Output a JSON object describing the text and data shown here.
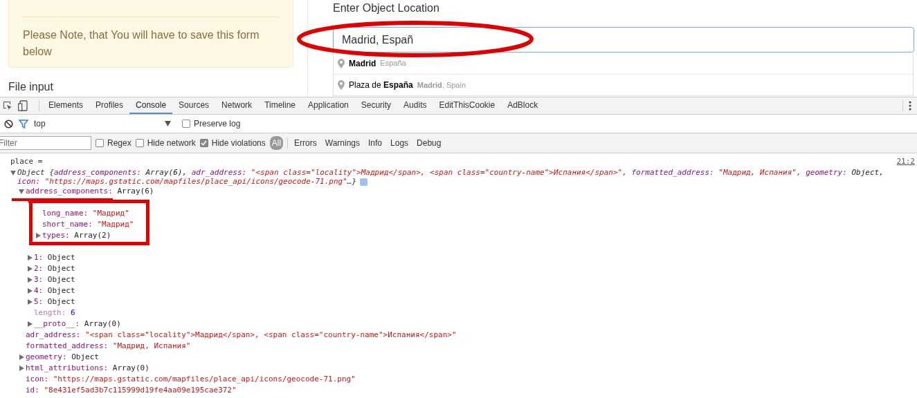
{
  "page": {
    "alert": {
      "text": "Please Note, that You will have to save this form below"
    },
    "file_label": "File input",
    "location": {
      "label": "Enter Object Location",
      "value": "Madrid, Españ",
      "suggestions": [
        {
          "main": "**Madrid**",
          "secondary": "España"
        },
        {
          "main": "Plaza de **España**",
          "secondary": "**Madrid**, Spain"
        }
      ]
    }
  },
  "devtools": {
    "tabs": [
      {
        "label": "Elements",
        "selected": false
      },
      {
        "label": "Profiles",
        "selected": false
      },
      {
        "label": "Console",
        "selected": true
      },
      {
        "label": "Sources",
        "selected": false
      },
      {
        "label": "Network",
        "selected": false
      },
      {
        "label": "Timeline",
        "selected": false
      },
      {
        "label": "Application",
        "selected": false
      },
      {
        "label": "Security",
        "selected": false
      },
      {
        "label": "Audits",
        "selected": false
      },
      {
        "label": "EditThisCookie",
        "selected": false
      },
      {
        "label": "AdBlock",
        "selected": false
      }
    ],
    "context": "top",
    "preserve_log": {
      "label": "Preserve log",
      "checked": false
    },
    "filter": {
      "placeholder": "Filter"
    },
    "options": [
      {
        "label": "Regex",
        "checked": false
      },
      {
        "label": "Hide network",
        "checked": false
      },
      {
        "label": "Hide violations",
        "checked": true
      }
    ],
    "levels": [
      {
        "label": "All",
        "selected": true
      },
      {
        "label": "Errors",
        "selected": false
      },
      {
        "label": "Warnings",
        "selected": false
      },
      {
        "label": "Info",
        "selected": false
      },
      {
        "label": "Logs",
        "selected": false
      },
      {
        "label": "Debug",
        "selected": false
      }
    ],
    "console": {
      "message": "place =",
      "timestamp": "21:2",
      "object": {
        "label": "Object {",
        "closing": "…}",
        "expanded": true,
        "summary": [
          {
            "key": "address_components:",
            "value": "Array(6),",
            "kind": "object"
          },
          {
            "key": "adr_address:",
            "value": "\"<span class=\"locality\">Мадрид</span>, <span class=\"country-name\">Испания</span>\",",
            "kind": "string"
          },
          {
            "key": "formatted_address:",
            "value": "\"Мадрид, Испания\",",
            "kind": "string"
          },
          {
            "key": "geometry:",
            "value": "Object,",
            "kind": "object"
          },
          {
            "key": "icon:",
            "value": "\"https://maps.gstatic.com/mapfiles/place_api/icons/geocode-71.png\"",
            "kind": "string"
          }
        ],
        "children": [
          {
            "key": "address_components:",
            "value": "Array(6)",
            "kind": "object",
            "expanded": true,
            "children": [
              {
                "expanded": true,
                "children": [
                  {
                    "key": "long_name:",
                    "value": "\"Мадрид\"",
                    "kind": "string"
                  },
                  {
                    "key": "short_name:",
                    "value": "\"Мадрид\"",
                    "kind": "string"
                  },
                  {
                    "key": "types:",
                    "value": "Array(2)",
                    "kind": "object",
                    "expanded": false
                  }
                ]
              },
              {
                "key": "1:",
                "value": "Object",
                "kind": "object",
                "expanded": false
              },
              {
                "key": "2:",
                "value": "Object",
                "kind": "object",
                "expanded": false
              },
              {
                "key": "3:",
                "value": "Object",
                "kind": "object",
                "expanded": false
              },
              {
                "key": "4:",
                "value": "Object",
                "kind": "object",
                "expanded": false
              },
              {
                "key": "5:",
                "value": "Object",
                "kind": "object",
                "expanded": false
              },
              {
                "key": "length:",
                "value": "6",
                "kind": "number",
                "internal": true
              },
              {
                "key": "__proto__:",
                "value": "Array(0)",
                "kind": "object",
                "expanded": false
              }
            ]
          },
          {
            "key": "adr_address:",
            "value": "\"<span class=\"locality\">Мадрид</span>, <span class=\"country-name\">Испания</span>\"",
            "kind": "string"
          },
          {
            "key": "formatted_address:",
            "value": "\"Мадрид, Испания\"",
            "kind": "string"
          },
          {
            "key": "geometry:",
            "value": "Object",
            "kind": "object",
            "expanded": false
          },
          {
            "key": "html_attributions:",
            "value": "Array(0)",
            "kind": "object",
            "expanded": false
          },
          {
            "key": "icon:",
            "value": "\"https://maps.gstatic.com/mapfiles/place_api/icons/geocode-71.png\"",
            "kind": "string"
          },
          {
            "key": "id:",
            "value": "\"8e431ef5ad3b7c115999d19fe4aa09e195cae372\"",
            "kind": "string"
          }
        ]
      }
    }
  },
  "annotations": [
    {
      "kind": "ellipse"
    },
    {
      "kind": "underline"
    },
    {
      "kind": "rectangle"
    }
  ]
}
